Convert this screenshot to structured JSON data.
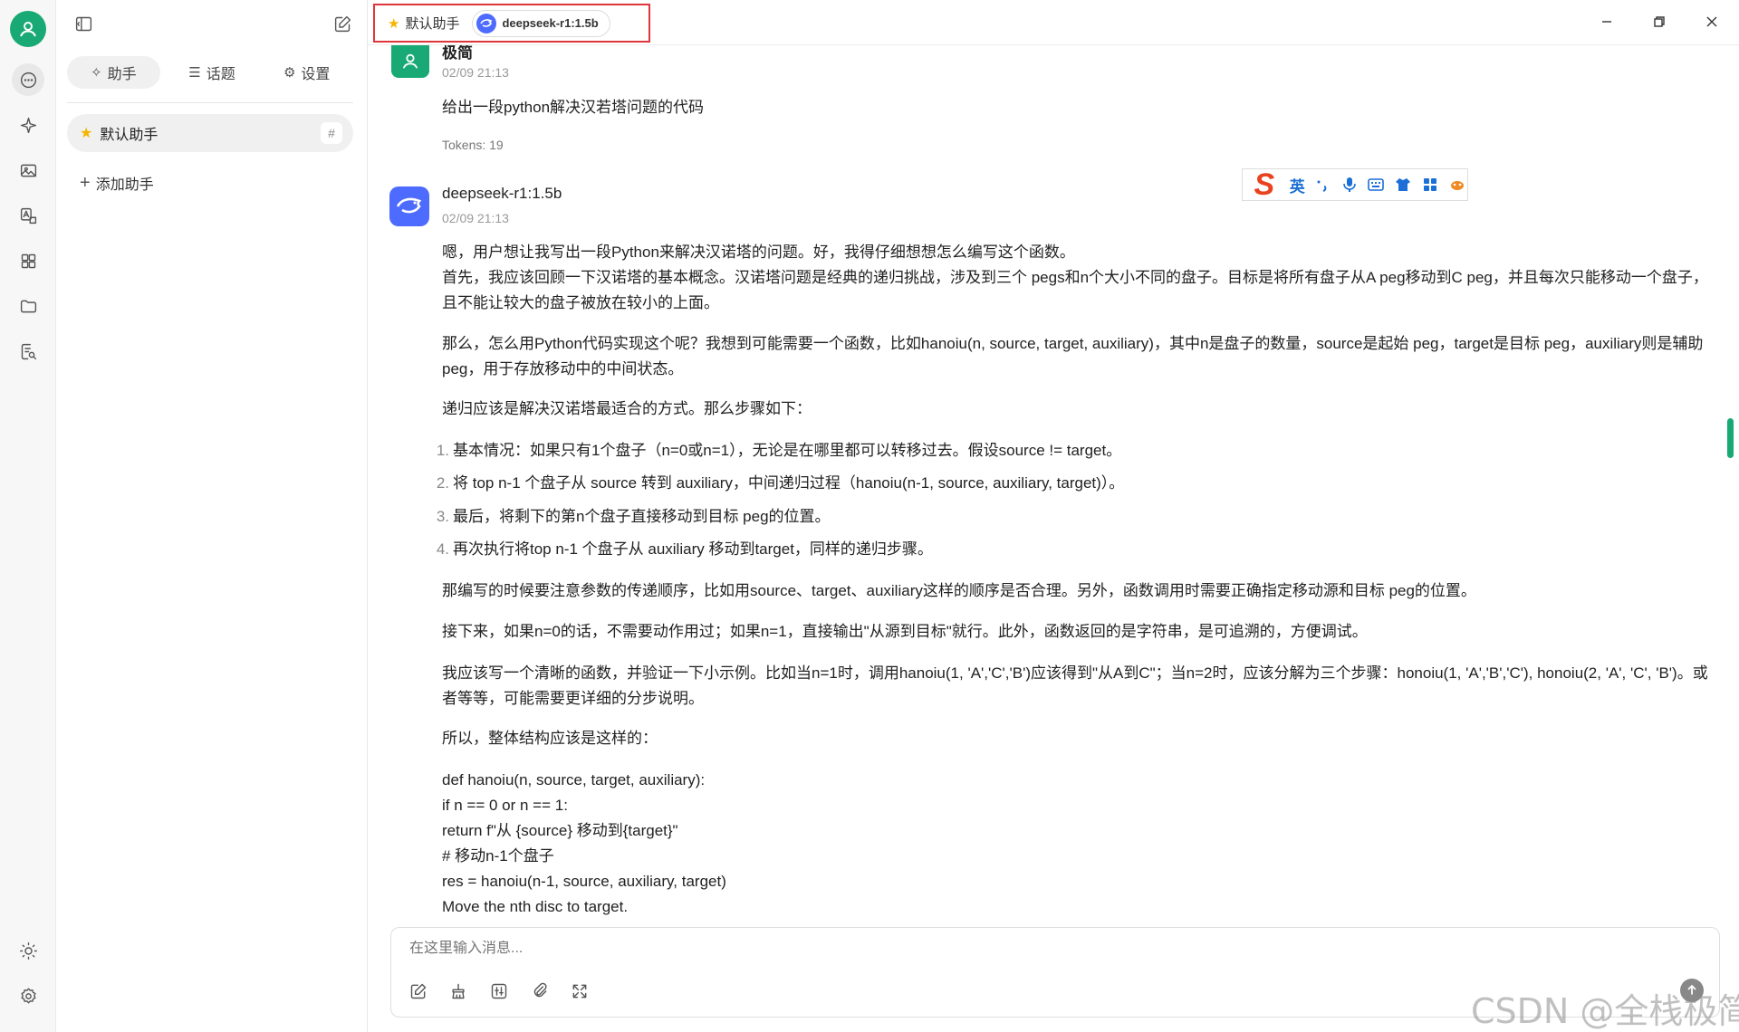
{
  "titlebar": {
    "assistant_label": "默认助手",
    "model_label": "deepseek-r1:1.5b"
  },
  "sidebar": {
    "tabs": [
      {
        "glyph": "✧",
        "label": "助手"
      },
      {
        "glyph": "☰",
        "label": "话题"
      },
      {
        "glyph": "⚙",
        "label": "设置"
      }
    ],
    "assistant_item": {
      "label": "默认助手",
      "hash": "#"
    },
    "add_label": "添加助手"
  },
  "messages": {
    "user": {
      "name": "极简",
      "time": "02/09 21:13",
      "text": "给出一段python解决汉若塔问题的代码",
      "tokens": "Tokens: 19"
    },
    "assistant": {
      "name": "deepseek-r1:1.5b",
      "time": "02/09 21:13",
      "intro1": "嗯，用户想让我写出一段Python来解决汉诺塔的问题。好，我得仔细想想怎么编写这个函数。",
      "intro2": "首先，我应该回顾一下汉诺塔的基本概念。汉诺塔问题是经典的递归挑战，涉及到三个 pegs和n个大小不同的盘子。目标是将所有盘子从A peg移动到C peg，并且每次只能移动一个盘子，且不能让较大的盘子被放在较小的上面。",
      "p2": "那么，怎么用Python代码实现这个呢？我想到可能需要一个函数，比如hanoiu(n, source, target, auxiliary)，其中n是盘子的数量，source是起始 peg，target是目标 peg，auxiliary则是辅助 peg，用于存放移动中的中间状态。",
      "p3": "递归应该是解决汉诺塔最适合的方式。那么步骤如下：",
      "list": [
        {
          "num": "1.",
          "text": "基本情况：如果只有1个盘子（n=0或n=1），无论是在哪里都可以转移过去。假设source != target。"
        },
        {
          "num": "2.",
          "text": "将 top n-1 个盘子从 source 转到 auxiliary，中间递归过程（hanoiu(n-1, source, auxiliary, target)）。"
        },
        {
          "num": "3.",
          "text": "最后，将剩下的第n个盘子直接移动到目标 peg的位置。"
        },
        {
          "num": "4.",
          "text": "再次执行将top n-1 个盘子从 auxiliary 移动到target，同样的递归步骤。"
        }
      ],
      "p4": "那编写的时候要注意参数的传递顺序，比如用source、target、auxiliary这样的顺序是否合理。另外，函数调用时需要正确指定移动源和目标 peg的位置。",
      "p5": "接下来，如果n=0的话，不需要动作用过；如果n=1，直接输出\"从源到目标\"就行。此外，函数返回的是字符串，是可追溯的，方便调试。",
      "p6": "我应该写一个清晰的函数，并验证一下小示例。比如当n=1时，调用hanoiu(1, 'A','C','B')应该得到\"从A到C\"；当n=2时，应该分解为三个步骤：honoiu(1, 'A','B','C'), honoiu(2, 'A', 'C', 'B')。或者等等，可能需要更详细的分步说明。",
      "p7": "所以，整体结构应该是这样的：",
      "code": [
        "def hanoiu(n, source, target, auxiliary):",
        "if n == 0 or n == 1:",
        "return f\"从 {source} 移动到{target}\"",
        "# 移动n-1个盘子",
        "res = hanoiu(n-1, source, auxiliary, target)",
        "Move the nth disc to target."
      ]
    }
  },
  "ime": {
    "logo": "S",
    "mode": "英"
  },
  "input": {
    "placeholder": "在这里输入消息..."
  },
  "watermark": "CSDN @全栈极简"
}
